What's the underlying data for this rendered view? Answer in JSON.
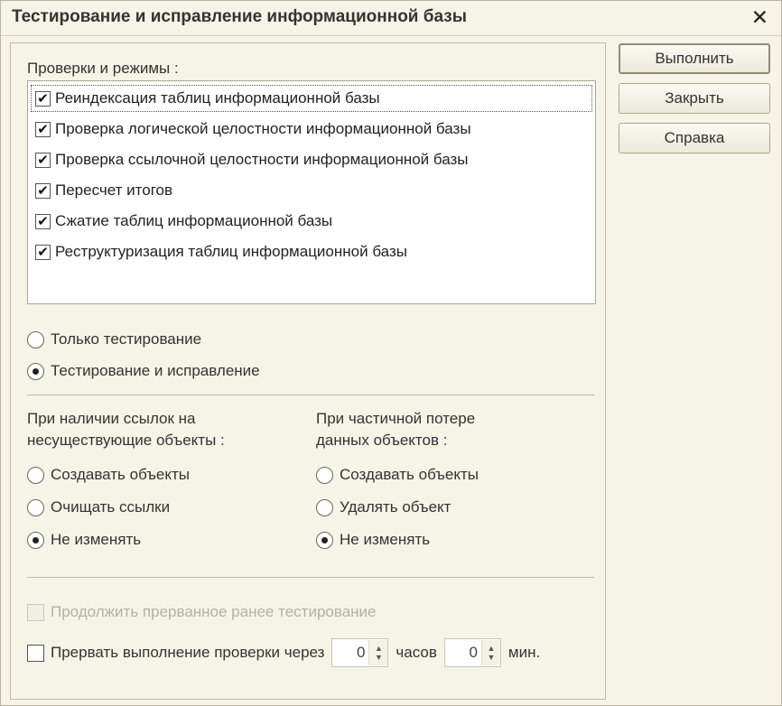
{
  "window": {
    "title": "Тестирование и исправление информационной базы",
    "close_glyph": "✕"
  },
  "checks": {
    "label": "Проверки и режимы :",
    "items": [
      {
        "label": "Реиндексация таблиц информационной базы",
        "checked": true
      },
      {
        "label": "Проверка логической целостности информационной базы",
        "checked": true
      },
      {
        "label": "Проверка ссылочной целостности информационной базы",
        "checked": true
      },
      {
        "label": "Пересчет итогов",
        "checked": true
      },
      {
        "label": "Сжатие таблиц информационной базы",
        "checked": true
      },
      {
        "label": "Реструктуризация таблиц информационной базы",
        "checked": true
      }
    ],
    "check_glyph": "✔"
  },
  "mode": {
    "only_testing": "Только тестирование",
    "testing_and_fix": "Тестирование и исправление",
    "selected": "testing_and_fix"
  },
  "refs": {
    "label_line1": "При наличии ссылок на",
    "label_line2": "несуществующие объекты :",
    "options": [
      "Создавать объекты",
      "Очищать ссылки",
      "Не изменять"
    ],
    "selected_index": 2
  },
  "loss": {
    "label_line1": "При частичной потере",
    "label_line2": "данных объектов :",
    "options": [
      "Создавать объекты",
      "Удалять объект",
      "Не изменять"
    ],
    "selected_index": 2
  },
  "resume": {
    "label": "Продолжить прерванное ранее тестирование",
    "enabled": false
  },
  "interrupt": {
    "label": "Прервать выполнение проверки через",
    "hours_value": "0",
    "hours_unit": "часов",
    "minutes_value": "0",
    "minutes_unit": "мин."
  },
  "buttons": {
    "run": "Выполнить",
    "close": "Закрыть",
    "help": "Справка"
  },
  "colors": {
    "window_bg": "#f5f4e6",
    "list_bg": "#ffffff",
    "disabled_text": "#b3b1a4"
  }
}
